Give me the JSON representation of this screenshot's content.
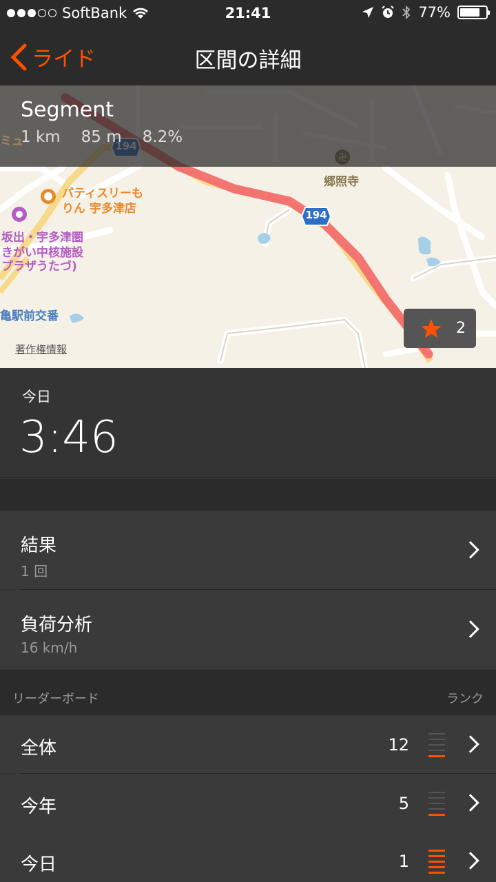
{
  "status_bar": {
    "carrier": "SoftBank",
    "time": "21:41",
    "battery": "77%",
    "battery_level": 0.77,
    "signal_bars_filled": 3,
    "signal_bars_total": 5
  },
  "nav": {
    "back_label": "ライド",
    "title": "区間の詳細"
  },
  "segment": {
    "name": "Segment",
    "distance": "1 km",
    "elevation": "85 m",
    "grade": "8.2%",
    "star_count": "2"
  },
  "map": {
    "labels": {
      "patisserie_line1": "パティスリーも",
      "patisserie_line2": "りん 宇多津店",
      "temple": "郷照寺",
      "facility_line1": "坂出・宇多津圏",
      "facility_line2": "きがい中核施設",
      "facility_line3": "プラザうたづ)",
      "police": "亀駅前交番",
      "partial_top": "ミュ",
      "route_number": "194",
      "copyright": "著作権情報"
    },
    "colors": {
      "route": "#f26b6b",
      "accent": "#fc5200",
      "poi_orange": "#e8892c",
      "poi_purple": "#b35ec2"
    }
  },
  "today": {
    "label": "今日",
    "time": "3:46"
  },
  "results": {
    "label": "結果",
    "value": "1 回"
  },
  "analysis": {
    "label": "負荷分析",
    "value": "16 km/h"
  },
  "leaderboard": {
    "header": "リーダーボード",
    "rank_header": "ランク",
    "rows": [
      {
        "label": "全体",
        "count": "12",
        "rank_level": 1
      },
      {
        "label": "今年",
        "count": "5",
        "rank_level": 1
      },
      {
        "label": "今日",
        "count": "1",
        "rank_level": 5
      }
    ]
  }
}
